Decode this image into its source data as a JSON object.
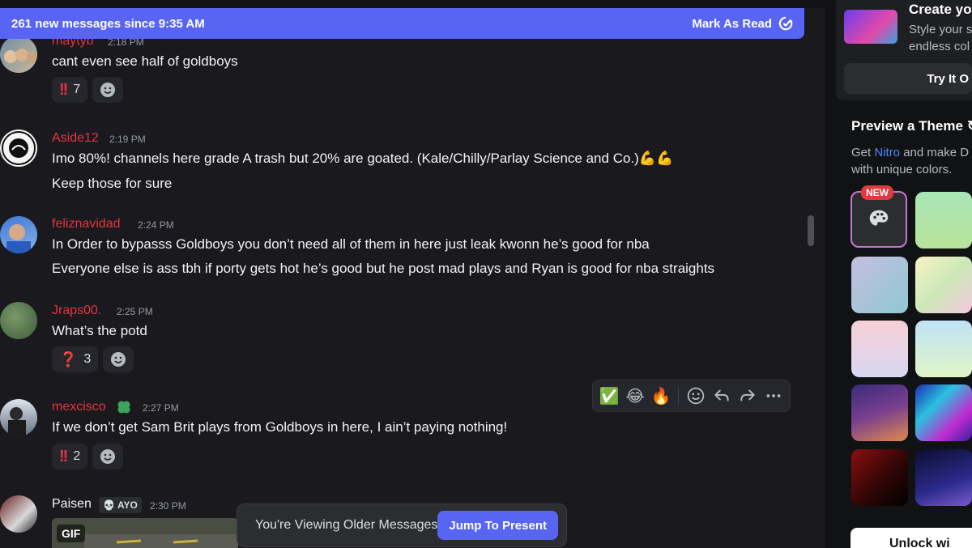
{
  "banner": {
    "text": "261 new messages since 9:35 AM",
    "mark_read": "Mark As Read"
  },
  "messages": [
    {
      "username": "maytyb",
      "time": "2:18 PM",
      "lines": [
        "cant even see half of goldboys"
      ],
      "reactions": [
        {
          "emoji": "!!",
          "count": "7"
        }
      ],
      "name_color": "#e3343f"
    },
    {
      "username": "Aside12",
      "time": "2:19 PM",
      "lines": [
        "Imo 80%! channels here grade A trash but 20% are goated. (Kale/Chilly/Parlay Science and Co.)💪💪",
        "Keep those for sure"
      ],
      "name_color": "#e3343f"
    },
    {
      "username": "feliznavidad",
      "time": "2:24 PM",
      "lines": [
        "In Order to bypasss Goldboys you don’t need all of them in here just leak kwonn he’s good for nba",
        "Everyone else is ass tbh if porty gets hot he’s good but he post mad plays and Ryan is good for nba straights"
      ],
      "name_color": "#e3343f"
    },
    {
      "username": "Jraps00.",
      "time": "2:25 PM",
      "lines": [
        "What’s the potd"
      ],
      "reactions": [
        {
          "emoji": "❓",
          "count": "3"
        }
      ],
      "name_color": "#e3343f"
    },
    {
      "username": "mexcisco",
      "time": "2:27 PM",
      "lines": [
        "If we don’t get Sam Brit plays from Goldboys in here, I ain’t paying nothing!"
      ],
      "reactions": [
        {
          "emoji": "!!",
          "count": "2"
        }
      ],
      "name_color": "#e3343f"
    },
    {
      "username": "Paisen",
      "time": "2:30 PM",
      "badge": "AYO",
      "gif_label": "GIF",
      "name_color": "#f2f3f5"
    }
  ],
  "hover_toolbar": {
    "quick_reactions": [
      "✅",
      "😂",
      "🔥"
    ]
  },
  "older_notice": {
    "text": "You're Viewing Older Messages",
    "jump": "Jump To Present"
  },
  "side_panel": {
    "promo_title": "Create yo",
    "promo_sub": "Style your s endless col",
    "try_button": "Try It O",
    "preview_title": "Preview a Theme",
    "preview_sub_pre": "Get",
    "preview_sub_link": "Nitro",
    "preview_sub_post": "and make D with unique colors.",
    "new_tag": "NEW",
    "unlock": "Unlock wi"
  },
  "colors": {
    "accent": "#5865f2",
    "background": "#1a1a1e",
    "danger": "#e3343f"
  }
}
